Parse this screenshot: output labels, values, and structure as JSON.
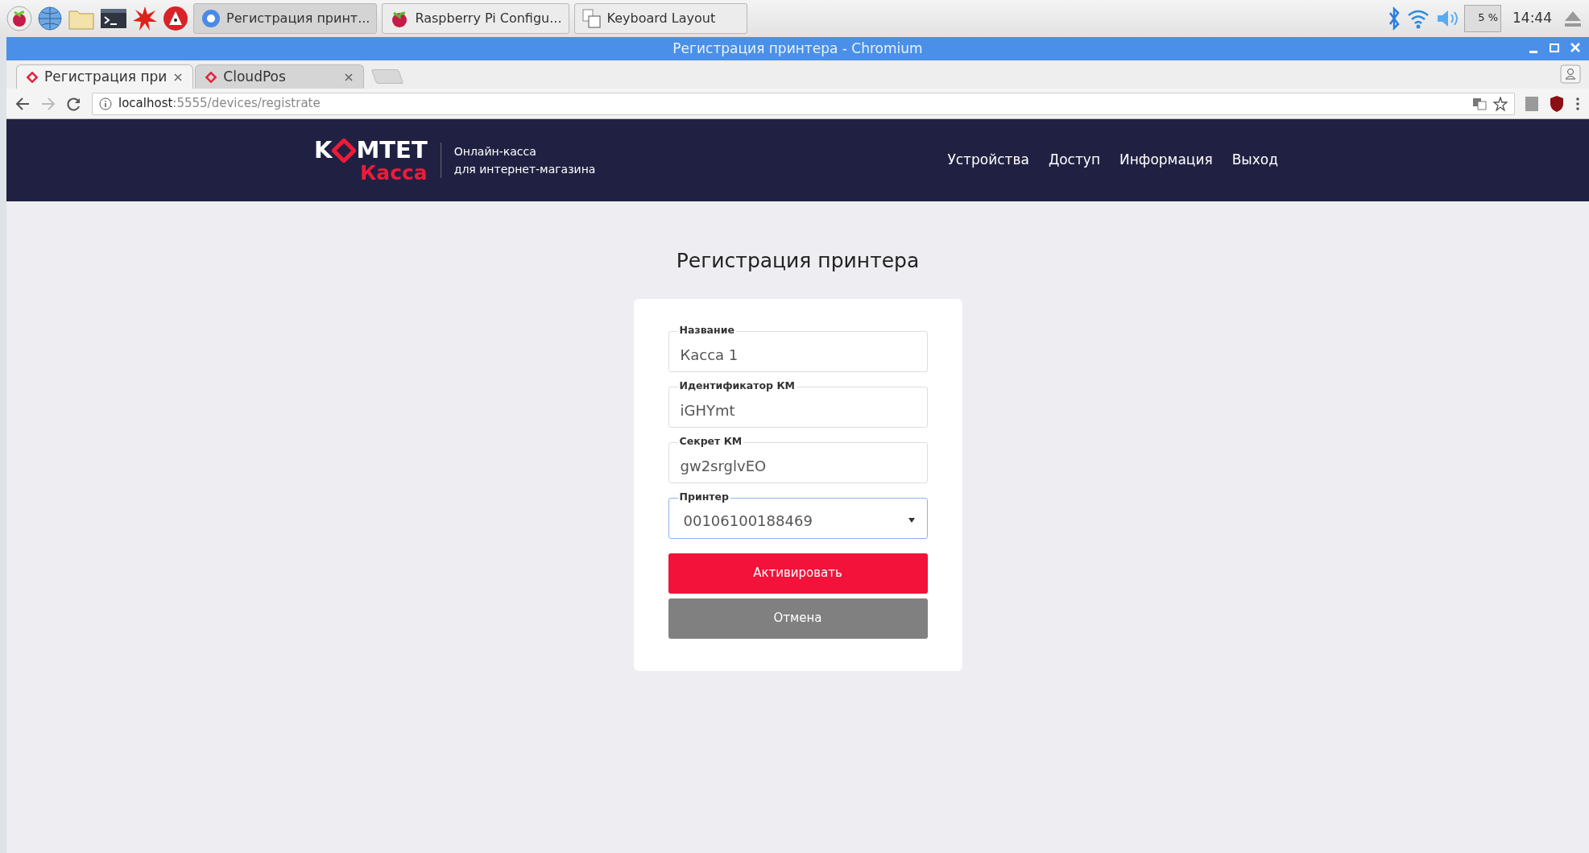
{
  "taskbar": {
    "tasks": [
      {
        "label": "Регистрация принт...",
        "selected": true
      },
      {
        "label": "Raspberry Pi Configu...",
        "selected": false
      },
      {
        "label": "Keyboard Layout",
        "selected": false
      }
    ],
    "cpu": "5 %",
    "clock": "14:44"
  },
  "window": {
    "title": "Регистрация принтера - Chromium"
  },
  "tabs": [
    {
      "label": "Регистрация при",
      "selected": true
    },
    {
      "label": "CloudPos",
      "selected": false
    }
  ],
  "address": {
    "host": "localhost",
    "path": ":5555/devices/registrate"
  },
  "site": {
    "logo": {
      "left": "K",
      "right": "MTET",
      "sub": "Касса"
    },
    "tagline": [
      "Онлайн-касса",
      "для интернет-магазина"
    ],
    "nav": [
      "Устройства",
      "Доступ",
      "Информация",
      "Выход"
    ]
  },
  "form": {
    "title": "Регистрация принтера",
    "fields": [
      {
        "kind": "text",
        "label": "Название",
        "value": "Касса 1",
        "focused": false
      },
      {
        "kind": "text",
        "label": "Идентификатор КМ",
        "value": "iGHYmt",
        "focused": false
      },
      {
        "kind": "text",
        "label": "Секрет КМ",
        "value": "gw2srglvEO",
        "focused": false
      },
      {
        "kind": "select",
        "label": "Принтер",
        "value": "00106100188469",
        "focused": true
      }
    ],
    "buttons": [
      {
        "kind": "primary",
        "label": "Активировать"
      },
      {
        "kind": "secondary",
        "label": "Отмена"
      }
    ]
  }
}
